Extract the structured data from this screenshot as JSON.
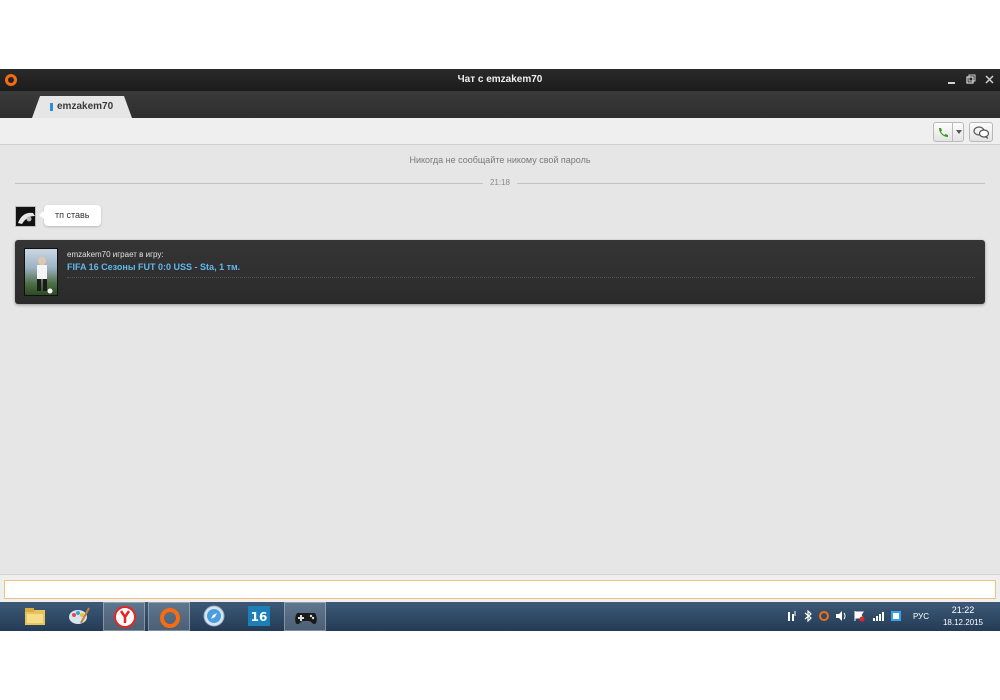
{
  "window": {
    "title": "Чат с emzakem70",
    "controls": [
      "minimize-icon",
      "restore-icon",
      "close-icon"
    ],
    "accent": "#f56c12"
  },
  "tab": {
    "label": "emzakem70"
  },
  "toolbar": {
    "call_icon": "phone-icon",
    "chat_icon": "chat-bubbles-icon"
  },
  "chat": {
    "warning": "Никогда не сообщайте никому свой пароль",
    "divider_time": "21:18",
    "message": {
      "text": "тп ставь"
    },
    "game_card": {
      "playing": "emzakem70 играет в игру:",
      "game": "FIFA 16 Сезоны FUT 0:0 USS - Sta, 1 тм."
    }
  },
  "input": {
    "value": "",
    "placeholder": ""
  },
  "taskbar": {
    "apps": [
      {
        "name": "file-explorer-icon",
        "active": false
      },
      {
        "name": "paint-icon",
        "active": false
      },
      {
        "name": "yandex-browser-icon",
        "active": true
      },
      {
        "name": "origin-icon",
        "active": true
      },
      {
        "name": "safari-icon",
        "active": false
      },
      {
        "name": "fifa16-icon",
        "active": false
      },
      {
        "name": "gamepad-icon",
        "active": true
      }
    ],
    "language": "РУС",
    "clock_time": "21:22",
    "clock_date": "18.12.2015"
  }
}
